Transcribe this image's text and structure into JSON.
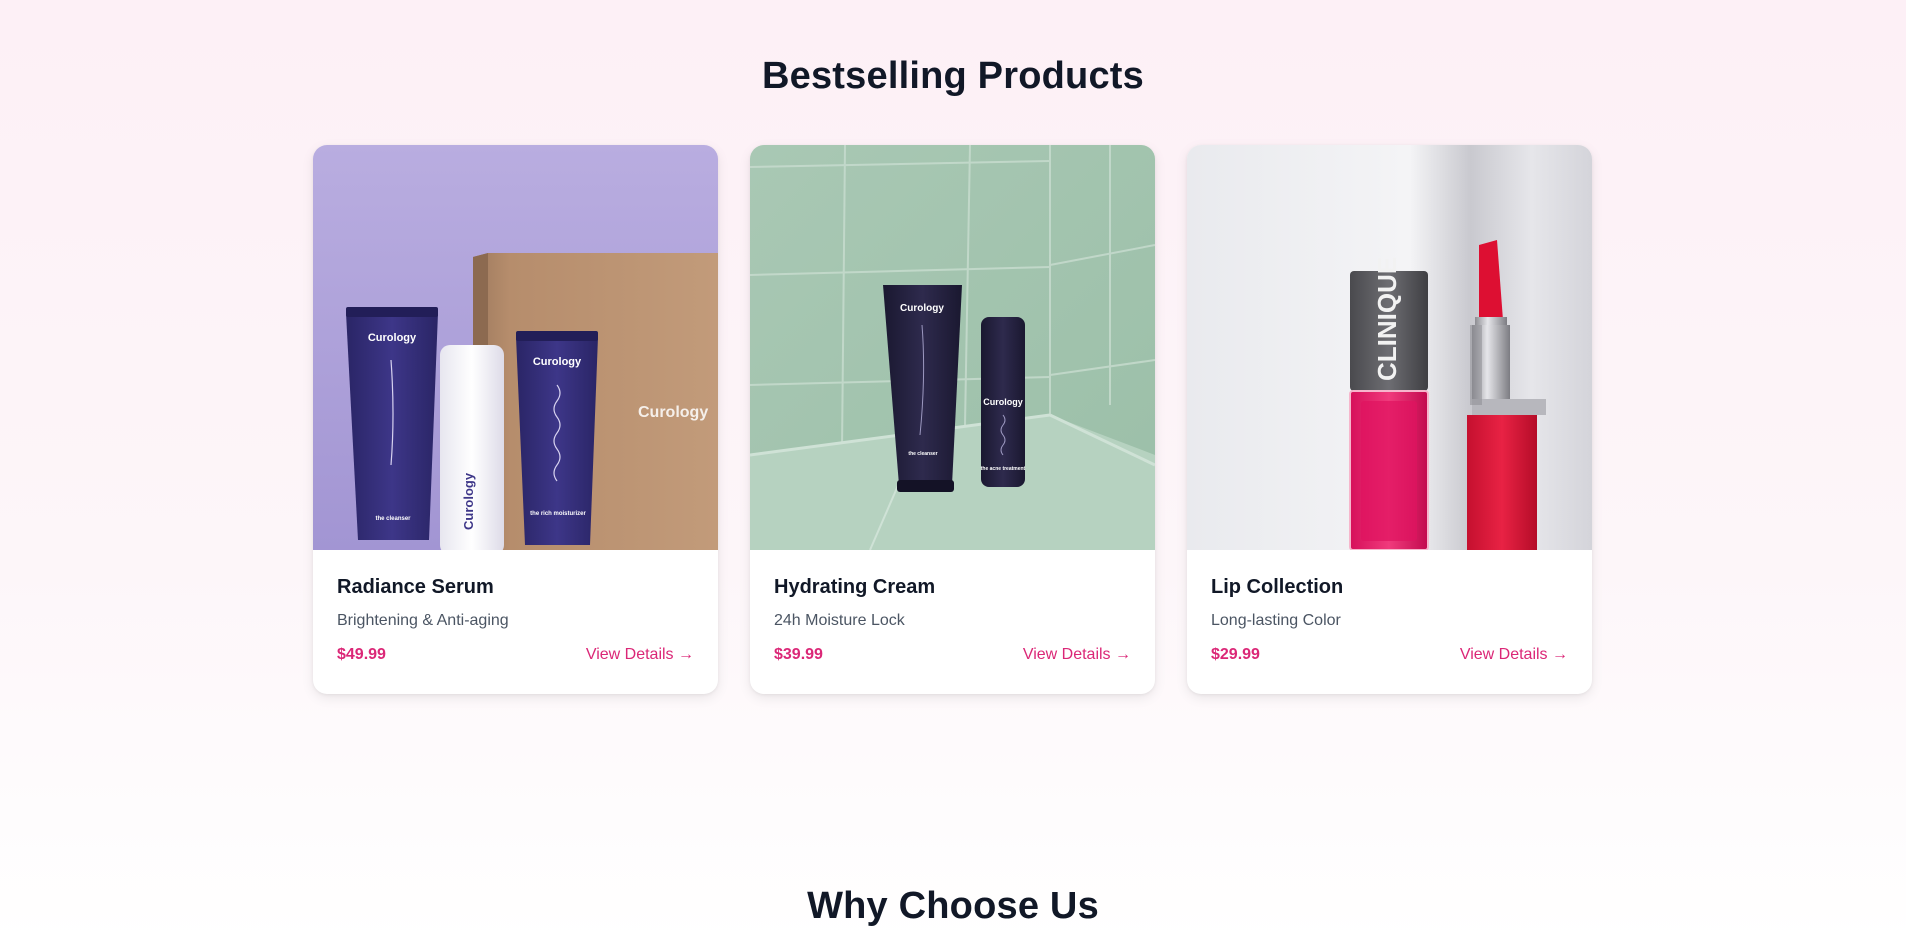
{
  "sections": {
    "bestselling_title": "Bestselling Products",
    "why_title": "Why Choose Us"
  },
  "products": [
    {
      "name": "Radiance Serum",
      "subtitle": "Brightening & Anti-aging",
      "price": "$49.99",
      "link": "View Details →",
      "image_brand": "Curology",
      "tube_labels": [
        "the cleanser",
        "the rich moisturizer"
      ]
    },
    {
      "name": "Hydrating Cream",
      "subtitle": "24h Moisture Lock",
      "price": "$39.99",
      "link": "View Details →",
      "image_brand": "Curology",
      "tube_labels": [
        "the cleanser",
        "the acne treatment"
      ]
    },
    {
      "name": "Lip Collection",
      "subtitle": "Long-lasting Color",
      "price": "$29.99",
      "link": "View Details →",
      "image_brand": "CLINIQUE"
    }
  ],
  "colors": {
    "accent": "#db2777",
    "heading": "#111827",
    "muted": "#4b5563"
  }
}
